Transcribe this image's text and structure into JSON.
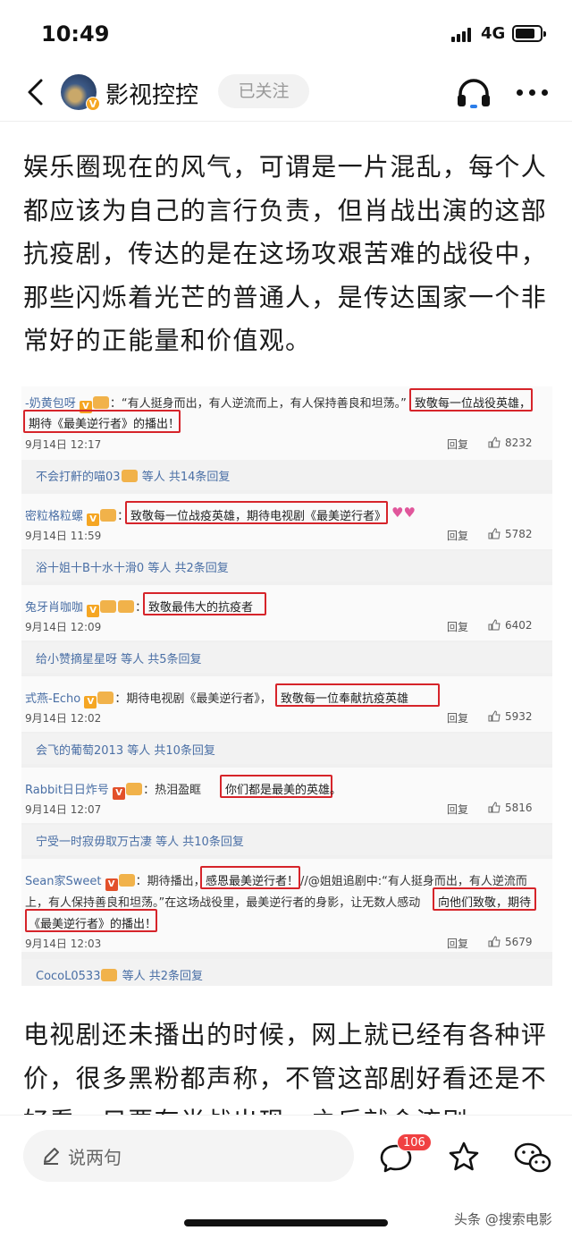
{
  "status_bar": {
    "time": "10:49",
    "network": "4G"
  },
  "nav": {
    "account_name": "影视控控",
    "follow_label": "已关注",
    "verified_mark": "V"
  },
  "article": {
    "para1": "娱乐圈现在的风气，可谓是一片混乱，每个人都应该为自己的言行负责，但肖战出演的这部抗疫剧，传达的是在这场攻艰苦难的战役中，那些闪烁着光芒的普通人，是传达国家一个非常好的正能量和价值观。",
    "para2": "电视剧还未播出的时候，网上就已经有各种评价，很多黑粉都声称，不管这部剧好看还是不好看，只要有肖战出现，之后就会流剧"
  },
  "screenshot": {
    "reply_label": "回复",
    "comments": [
      {
        "user": "-奶黄包呀",
        "text_before": "：“有人挺身而出，有人逆流而上，有人保持善良和坦荡。”",
        "highlight_1": "致敬每一位战役英雄，",
        "highlight_2": "期待《最美逆行者》的播出！",
        "date": "9月14日 12:17",
        "likes": "8232"
      },
      {
        "user": "密粒格粒螺",
        "text_before": "：",
        "highlight_1": "致敬每一位战疫英雄，期待电视剧《最美逆行者》",
        "date": "9月14日 11:59",
        "likes": "5782"
      },
      {
        "user": "兔牙肖咖咖",
        "text_before": "：",
        "highlight_1": "致敬最伟大的抗疫者",
        "date": "9月14日 12:09",
        "likes": "6402"
      },
      {
        "user": "式燕-Echo",
        "text_before": "：期待电视剧《最美逆行者》，",
        "highlight_1": "致敬每一位奉献抗疫英雄",
        "date": "9月14日 12:02",
        "likes": "5932"
      },
      {
        "user": "Rabbit日日炸号",
        "text_before": "：热泪盈眶",
        "highlight_1": "你们都是最美的英雄。",
        "date": "9月14日 12:07",
        "likes": "5816"
      },
      {
        "user": "Sean家Sweet",
        "text_before": "：期待播出，",
        "highlight_1": "感恩最美逆行者！",
        "text_mid": "//@姐姐追剧中:“有人挺身而出，有人逆流而",
        "line2": "上，有人保持善良和坦荡。”在这场战役里，最美逆行者的身影，让无数人感动",
        "highlight_2": "向他们致敬，期待",
        "highlight_3": "《最美逆行者》的播出！",
        "date": "9月14日 12:03",
        "likes": "5679"
      }
    ],
    "reply_summaries": [
      {
        "user": "不会打鼾的喵03",
        "text": "等人 共14条回复"
      },
      {
        "user": "浴十姐十B十水十滑0",
        "text": "等人 共2条回复"
      },
      {
        "user": "给小赞摘星星呀",
        "text": "等人 共5条回复"
      },
      {
        "user": "会飞的葡萄2013",
        "text": "等人 共10条回复"
      },
      {
        "user": "宁受一时寂毋取万古凄",
        "text": "等人 共10条回复"
      },
      {
        "user": "CocoL0533",
        "text": "等人 共2条回复"
      }
    ]
  },
  "bottom_bar": {
    "placeholder": "说两句",
    "comment_count": "106"
  },
  "watermark": "头条 @搜索电影"
}
